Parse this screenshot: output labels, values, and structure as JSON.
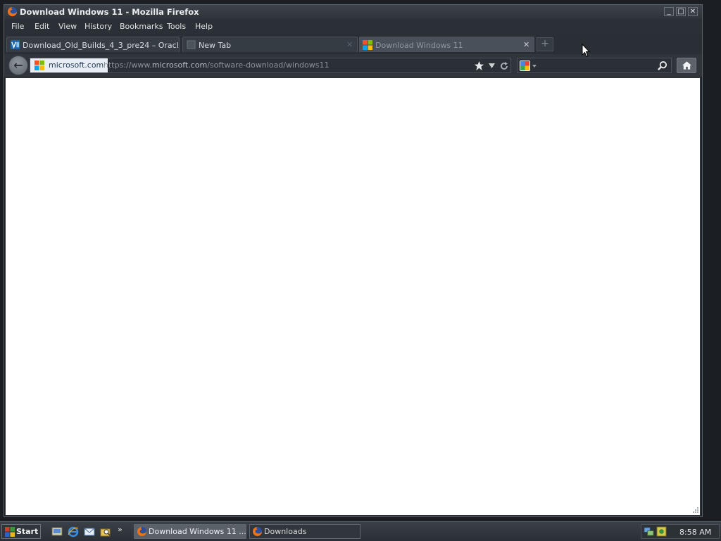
{
  "window": {
    "title": "Download Windows 11 - Mozilla Firefox",
    "controls": {
      "minimize": "_",
      "maximize": "□",
      "close": "✕"
    }
  },
  "menu": [
    "File",
    "Edit",
    "View",
    "History",
    "Bookmarks",
    "Tools",
    "Help"
  ],
  "tabs": [
    {
      "label": "Download_Old_Builds_4_3_pre24 – Oracl...",
      "icon": "virtualbox-icon",
      "active": false
    },
    {
      "label": "New Tab",
      "icon": "blank-page-icon",
      "active": false
    },
    {
      "label": "Download Windows 11",
      "icon": "microsoft-icon",
      "active": true
    }
  ],
  "new_tab_symbol": "+",
  "navbar": {
    "back_symbol": "←",
    "identity": "microsoft.com",
    "url_scheme": "https://www.",
    "url_host": "microsoft.com",
    "url_path": "/software-download/windows11",
    "search_value": ""
  },
  "taskbar": {
    "start_label": "Start",
    "tasks": [
      {
        "label": "Download Windows 11 ...",
        "icon": "firefox-icon",
        "active": true
      },
      {
        "label": "Downloads",
        "icon": "firefox-icon",
        "active": false
      }
    ],
    "quicklaunch_more": "»",
    "clock": "8:58 AM"
  },
  "colors": {
    "frame": "#2d3238",
    "content": "#ffffff",
    "identity_bg": "#e9eef4",
    "taskbar": "#2a2f35"
  }
}
